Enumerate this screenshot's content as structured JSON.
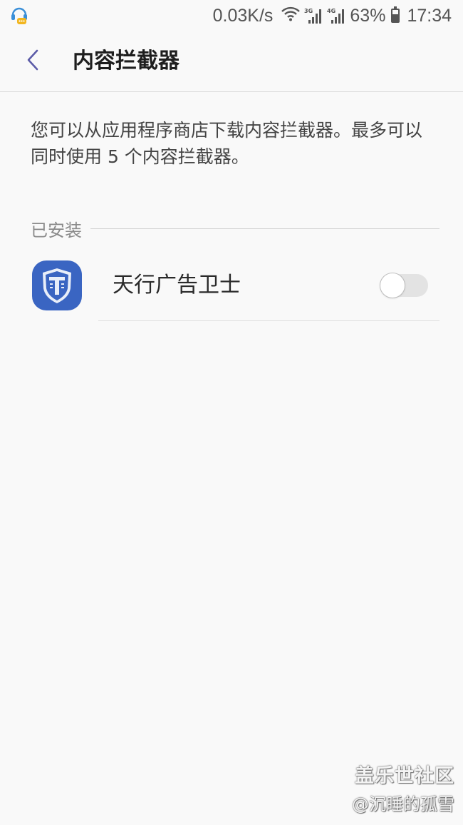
{
  "status_bar": {
    "net_speed": "0.03K/s",
    "sig1_label": "3G",
    "sig2_label": "4G",
    "battery_percent": "63%",
    "battery_level": 0.63,
    "time": "17:34",
    "icons": [
      "notification-headset-icon",
      "wifi-icon",
      "signal-3g-icon",
      "signal-4g-icon",
      "battery-icon"
    ]
  },
  "header": {
    "back_icon": "chevron-left-icon",
    "title": "内容拦截器"
  },
  "description": "您可以从应用程序商店下载内容拦截器。最多可以同时使用 5 个内容拦截器。",
  "installed_section": {
    "label": "已安装",
    "items": [
      {
        "name": "天行广告卫士",
        "icon": "tianxing-shield-app-icon",
        "enabled": false
      }
    ]
  },
  "colors": {
    "background": "#f9f9f9",
    "accent": "#5c5ca8",
    "app_icon_blue": "#3a65c2",
    "toggle_track": "#e3e3e3"
  },
  "watermark": {
    "line1": "盖乐世社区",
    "line2": "@沉睡的孤雪"
  }
}
